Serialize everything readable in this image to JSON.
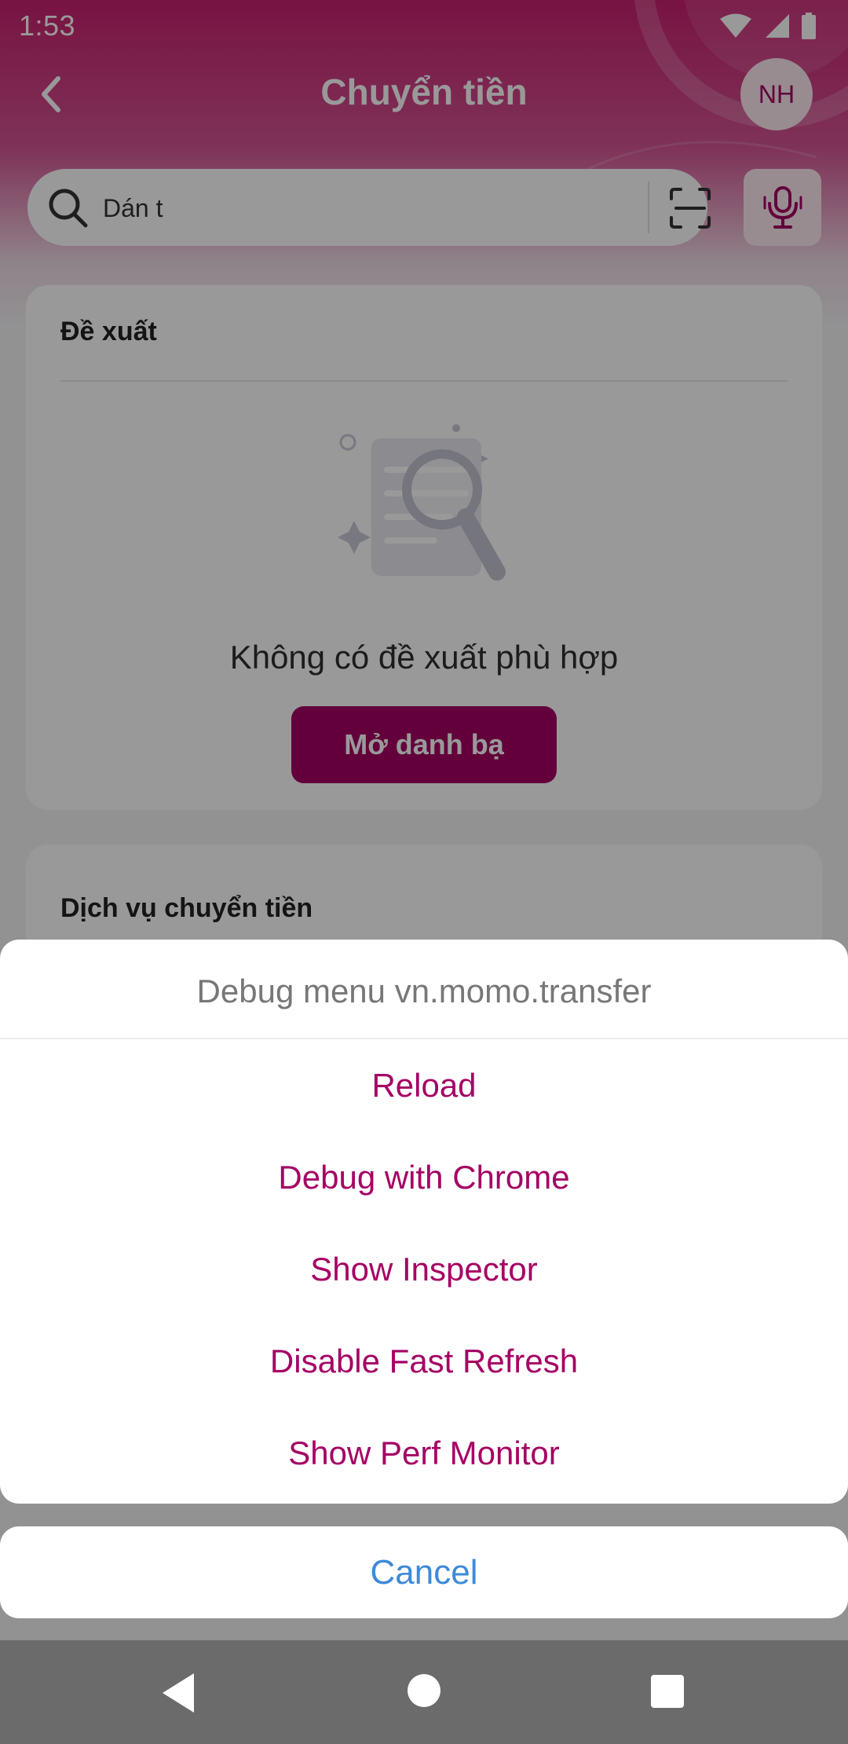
{
  "status_bar": {
    "time": "1:53"
  },
  "header": {
    "title": "Chuyển tiền",
    "avatar_initials": "NH"
  },
  "search": {
    "value": "Dán t",
    "placeholder": ""
  },
  "suggestions_card": {
    "title": "Đề xuất",
    "empty_text": "Không có đề xuất phù hợp",
    "open_contacts_label": "Mở danh bạ"
  },
  "services_card": {
    "title": "Dịch vụ chuyển tiền"
  },
  "debug_menu": {
    "title": "Debug menu vn.momo.transfer",
    "items": [
      {
        "label": "Reload"
      },
      {
        "label": "Debug with Chrome"
      },
      {
        "label": "Show Inspector"
      },
      {
        "label": "Disable Fast Refresh"
      },
      {
        "label": "Show Perf Monitor"
      }
    ],
    "cancel_label": "Cancel"
  },
  "colors": {
    "brand": "#a50064",
    "cancel_blue": "#3d8ad8",
    "menu_title_gray": "#777777"
  }
}
